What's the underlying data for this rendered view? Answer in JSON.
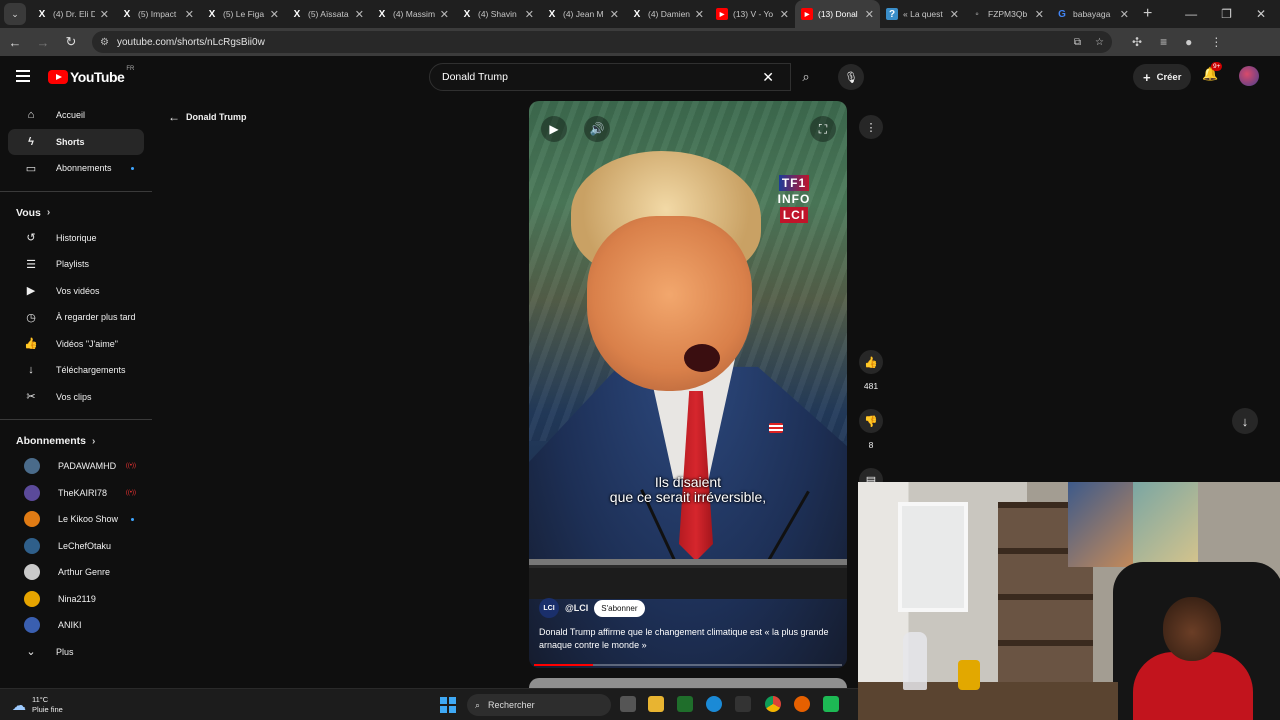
{
  "browser": {
    "tabs": [
      {
        "title": "(4) Dr. Eli D",
        "favicon": "X"
      },
      {
        "title": "(5) Impact",
        "favicon": "X"
      },
      {
        "title": "(5) Le Figa",
        "favicon": "X"
      },
      {
        "title": "(5) Aïssata",
        "favicon": "X"
      },
      {
        "title": "(4) Massim",
        "favicon": "X"
      },
      {
        "title": "(4) Shavin",
        "favicon": "X"
      },
      {
        "title": "(4) Jean M",
        "favicon": "X"
      },
      {
        "title": "(4) Damien",
        "favicon": "X"
      },
      {
        "title": "(13) V - Yo",
        "favicon": "youtube-icon"
      },
      {
        "title": "(13) Donal",
        "favicon": "youtube-icon",
        "active": true
      },
      {
        "title": "« La quest",
        "favicon": "tab-icon"
      },
      {
        "title": "FZPM3Qb",
        "favicon": "web-icon"
      },
      {
        "title": "babayaga",
        "favicon": "google-icon"
      }
    ],
    "url": "youtube.com/shorts/nLcRgsBii0w"
  },
  "header": {
    "logo_text": "YouTube",
    "logo_region": "FR",
    "search_value": "Donald Trump",
    "create_label": "Créer",
    "notifications_badge": "9+"
  },
  "sidebar": {
    "main_items": [
      {
        "label": "Accueil",
        "icon": "home-icon"
      },
      {
        "label": "Shorts",
        "icon": "shorts-icon",
        "active": true
      },
      {
        "label": "Abonnements",
        "icon": "subscriptions-icon",
        "dot": true
      }
    ],
    "you_heading": "Vous",
    "you_items": [
      {
        "label": "Historique",
        "icon": "history-icon"
      },
      {
        "label": "Playlists",
        "icon": "playlist-icon"
      },
      {
        "label": "Vos vidéos",
        "icon": "video-icon"
      },
      {
        "label": "À regarder plus tard",
        "icon": "clock-icon"
      },
      {
        "label": "Vidéos \"J'aime\"",
        "icon": "thumbs-up-icon"
      },
      {
        "label": "Téléchargements",
        "icon": "download-icon"
      },
      {
        "label": "Vos clips",
        "icon": "scissors-icon"
      }
    ],
    "subs_heading": "Abonnements",
    "subscriptions": [
      {
        "label": "PADAWAMHD",
        "color": "#4a6b8a",
        "live": true
      },
      {
        "label": "TheKAIRI78",
        "color": "#5b4a9a",
        "live": true
      },
      {
        "label": "Le Kikoo Show",
        "color": "#e07b14",
        "dot": true
      },
      {
        "label": "LeChefOtaku",
        "color": "#2f5f8a"
      },
      {
        "label": "Arthur Genre",
        "color": "#c9c9c9"
      },
      {
        "label": "Nina2119",
        "color": "#e6a400"
      },
      {
        "label": "ANIKI",
        "color": "#3a5fb0"
      }
    ],
    "more_label": "Plus"
  },
  "back_link": "Donald Trump",
  "short": {
    "subtitle_line1": "Ils disaient",
    "subtitle_line2": "que ce serait irréversible,",
    "channel_handle": "@LCI",
    "channel_avatar_text": "LCI",
    "subscribe_label": "S'abonner",
    "description": "Donald Trump affirme que le changement climatique est « la plus grande arnaque contre le monde »",
    "watermark": [
      "TF1",
      "INFO",
      "LCI"
    ],
    "progress": 0.19
  },
  "actions": {
    "likes": "481",
    "dislikes": "8"
  },
  "taskbar": {
    "temperature": "11°C",
    "weather": "Pluie fine",
    "search_placeholder": "Rechercher"
  },
  "colors": {
    "accent_red": "#ff0000",
    "background": "#0f0f0f"
  }
}
